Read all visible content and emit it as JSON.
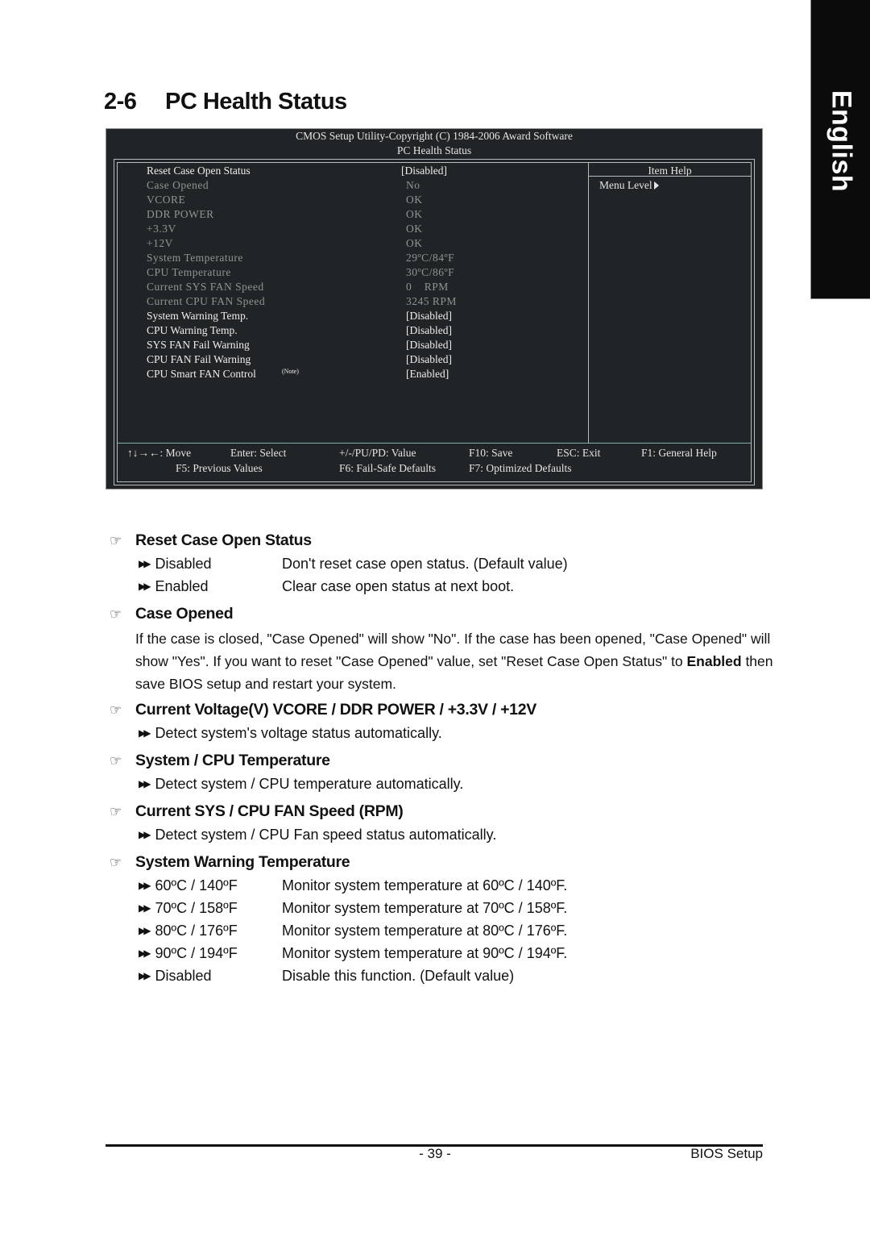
{
  "side_tab": {
    "label": "English"
  },
  "title": {
    "number": "2-6",
    "text": "PC Health Status"
  },
  "bios": {
    "header_line1": "CMOS Setup Utility-Copyright (C) 1984-2006 Award Software",
    "header_line2": "PC Health Status",
    "item_help_title": "Item Help",
    "menu_level": "Menu Level",
    "items": [
      {
        "label": "Reset Case Open Status",
        "value": "[Disabled]",
        "state": "active"
      },
      {
        "label": "Case Opened",
        "value": "No",
        "state": "dim"
      },
      {
        "label": "VCORE",
        "value": "OK",
        "state": "dim"
      },
      {
        "label": "DDR POWER",
        "value": "OK",
        "state": "dim"
      },
      {
        "label": "+3.3V",
        "value": "OK",
        "state": "dim"
      },
      {
        "label": "+12V",
        "value": "OK",
        "state": "dim"
      },
      {
        "label": "System Temperature",
        "value": "29ºC/84ºF",
        "state": "dim"
      },
      {
        "label": "CPU Temperature",
        "value": "30ºC/86ºF",
        "state": "dim"
      },
      {
        "label": "Current SYS FAN Speed",
        "value": "0    RPM",
        "state": "dim"
      },
      {
        "label": "Current CPU FAN Speed",
        "value": "3245 RPM",
        "state": "dim"
      },
      {
        "label": "System Warning Temp.",
        "value": "[Disabled]",
        "state": "active"
      },
      {
        "label": "CPU Warning Temp.",
        "value": "[Disabled]",
        "state": "active"
      },
      {
        "label": "SYS FAN Fail Warning",
        "value": "[Disabled]",
        "state": "active"
      },
      {
        "label": "CPU FAN Fail Warning",
        "value": "[Disabled]",
        "state": "active"
      },
      {
        "label": "CPU Smart FAN Control",
        "note": "(Note)",
        "value": "[Enabled]",
        "state": "active"
      }
    ],
    "keys": {
      "move": "↑↓→←: Move",
      "enter": "Enter: Select",
      "value": "+/-/PU/PD: Value",
      "f10": "F10: Save",
      "esc": "ESC: Exit",
      "f1": "F1: General Help",
      "f5": "F5: Previous Values",
      "f6": "F6: Fail-Safe Defaults",
      "f7": "F7: Optimized Defaults"
    }
  },
  "sections": {
    "reset_case": {
      "heading": "Reset Case Open Status",
      "options": [
        {
          "name": "Disabled",
          "desc": "Don't reset case open status. (Default value)"
        },
        {
          "name": "Enabled",
          "desc": "Clear case open status at next boot."
        }
      ]
    },
    "case_opened": {
      "heading": "Case Opened",
      "para_part1": "If the case is closed, \"Case Opened\" will show \"No\". If the case has been opened, \"Case Opened\" will show \"Yes\". If you want to reset \"Case Opened\" value, set \"Reset Case Open Status\" to ",
      "para_bold": "Enabled",
      "para_part2": " then save BIOS setup and restart your system."
    },
    "voltage": {
      "heading": "Current Voltage(V) VCORE / DDR POWER / +3.3V / +12V",
      "bullet": "Detect system's voltage status automatically."
    },
    "temperature": {
      "heading": "System / CPU Temperature",
      "bullet": "Detect system / CPU temperature automatically."
    },
    "fan_speed": {
      "heading": "Current SYS / CPU FAN Speed (RPM)",
      "bullet": "Detect system / CPU Fan speed status automatically."
    },
    "warning_temp": {
      "heading": "System Warning Temperature",
      "options": [
        {
          "name": "60ºC / 140ºF",
          "desc": "Monitor system temperature at 60ºC / 140ºF."
        },
        {
          "name": "70ºC / 158ºF",
          "desc": "Monitor system temperature at 70ºC / 158ºF."
        },
        {
          "name": "80ºC / 176ºF",
          "desc": "Monitor system temperature at 80ºC / 176ºF."
        },
        {
          "name": "90ºC / 194ºF",
          "desc": "Monitor system temperature at 90ºC / 194ºF."
        },
        {
          "name": "Disabled",
          "desc": "Disable this function. (Default value)"
        }
      ]
    }
  },
  "icons": {
    "section_marker": "pointing-hand-icon",
    "option_marker": "double-arrow-icon"
  },
  "footer": {
    "page_number": "- 39 -",
    "section": "BIOS Setup"
  }
}
